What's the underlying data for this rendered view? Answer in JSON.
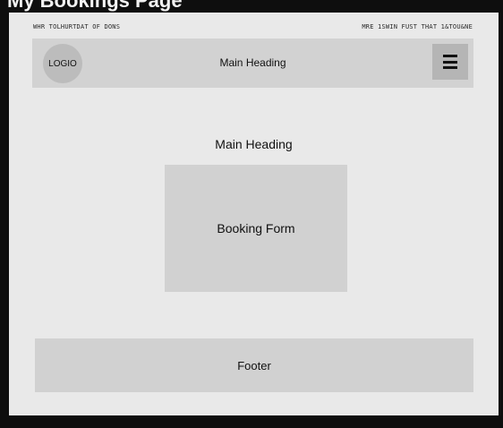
{
  "page": {
    "title": "My Bookings Page"
  },
  "top_bar": {
    "left_text": "WHR TOLHURTDAT OF DONS",
    "right_text": "MRE 1SWIN FUST THAT 1&TOU&NE"
  },
  "header": {
    "logo_text": "LOGIO",
    "title": "Main Heading",
    "menu_icon": "hamburger-menu-icon"
  },
  "main": {
    "heading": "Main Heading",
    "booking_form_label": "Booking Form"
  },
  "footer": {
    "label": "Footer"
  }
}
